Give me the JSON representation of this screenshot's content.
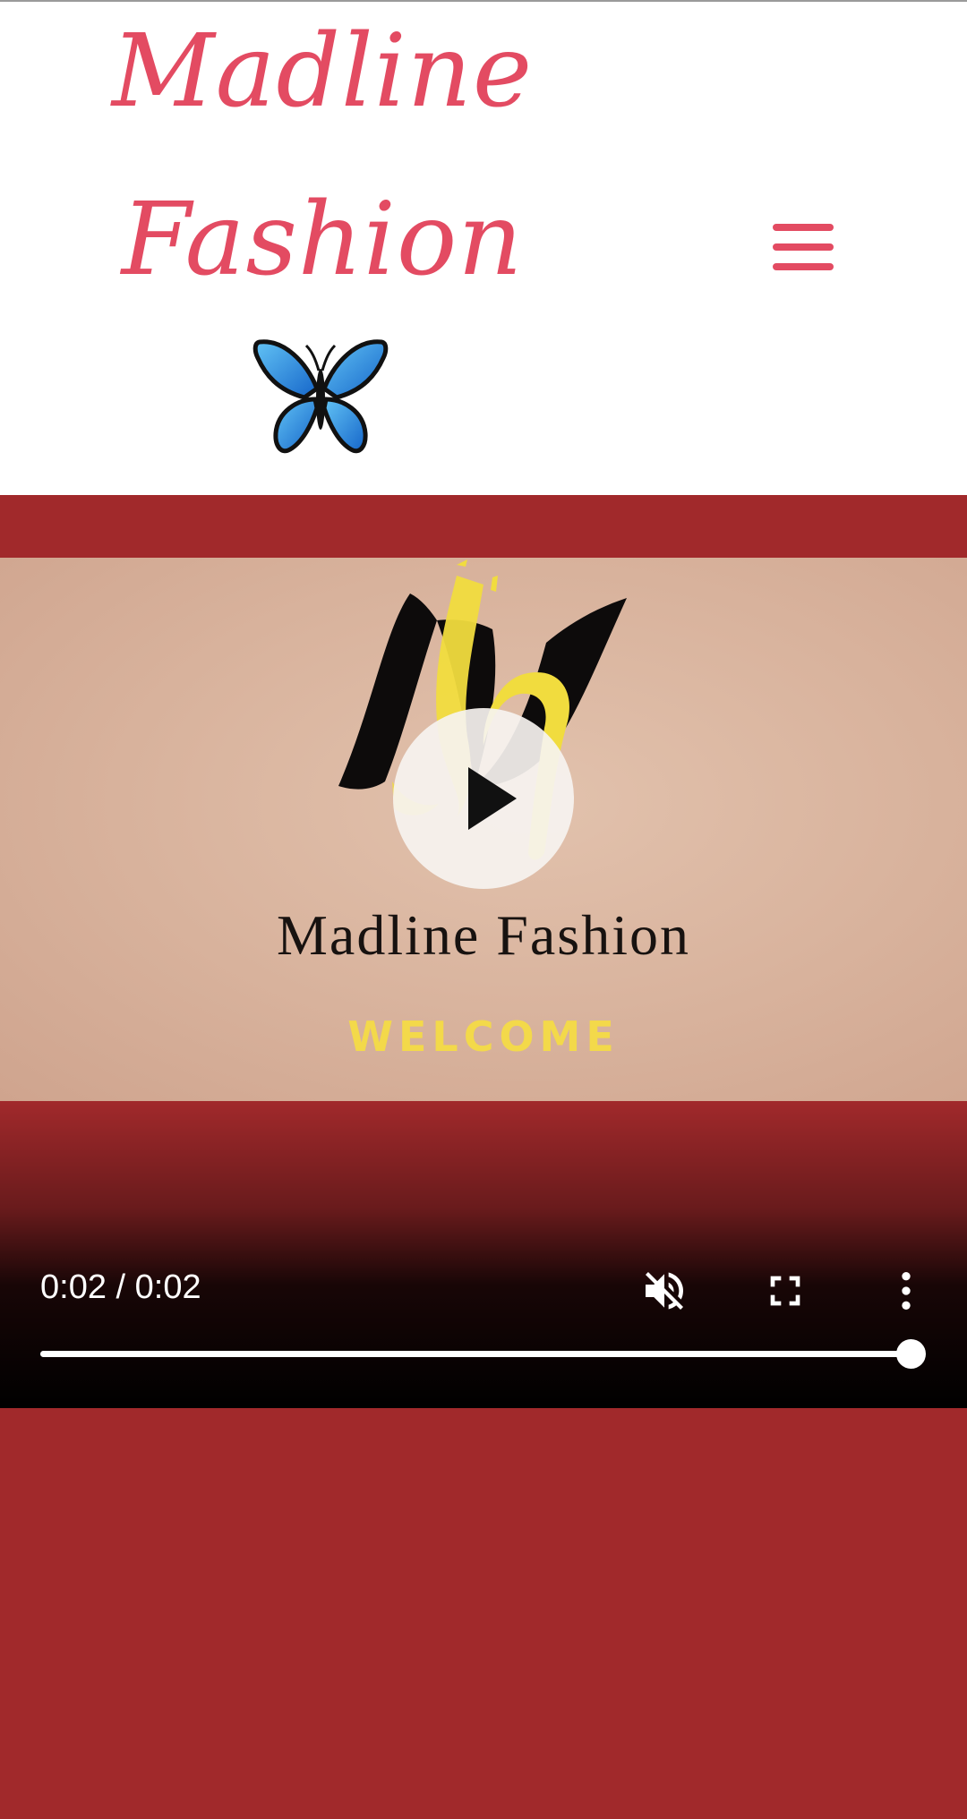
{
  "header": {
    "brand_line_1": "Madline",
    "brand_line_2": "Fashion",
    "brand_emoji": "butterfly-icon",
    "menu_icon": "hamburger-menu-icon",
    "brand_color": "#e34b62"
  },
  "video": {
    "logo_text": "Madline Fashion",
    "welcome_text": "WELCOME",
    "play_icon": "play-icon",
    "current_time": "0:02",
    "duration": "0:02",
    "time_display": "0:02 / 0:02",
    "progress": 1.0,
    "muted": true,
    "mute_icon": "volume-muted-icon",
    "fullscreen_icon": "fullscreen-icon",
    "more_icon": "more-vertical-icon"
  },
  "colors": {
    "page_background": "#a1292b",
    "header_background": "#ffffff",
    "video_backdrop": "#d8b29c",
    "welcome_yellow": "#f3d94a"
  }
}
